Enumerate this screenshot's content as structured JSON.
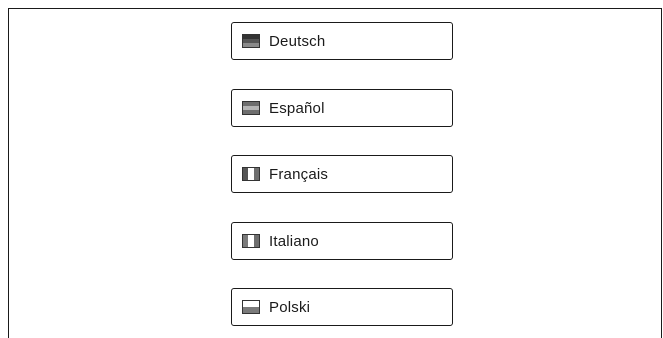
{
  "languages": [
    {
      "label": "Deutsch",
      "flag_icon": "flag-germany-icon",
      "stripes": "horizontal",
      "colors": [
        "#333333",
        "#555555",
        "#8a8a8a"
      ]
    },
    {
      "label": "Español",
      "flag_icon": "flag-spain-icon",
      "stripes": "horizontal",
      "colors": [
        "#6e6e6e",
        "#b5b5b5",
        "#6e6e6e"
      ]
    },
    {
      "label": "Français",
      "flag_icon": "flag-france-icon",
      "stripes": "vertical",
      "colors": [
        "#555555",
        "#ffffff",
        "#6e6e6e"
      ]
    },
    {
      "label": "Italiano",
      "flag_icon": "flag-italy-icon",
      "stripes": "vertical",
      "colors": [
        "#7a7a7a",
        "#ffffff",
        "#6e6e6e"
      ]
    },
    {
      "label": "Polski",
      "flag_icon": "flag-poland-icon",
      "stripes": "horizontal",
      "colors": [
        "#ffffff",
        "#7a7a7a"
      ]
    }
  ]
}
